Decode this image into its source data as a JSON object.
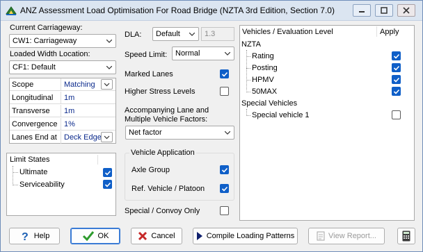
{
  "window": {
    "title": "ANZ Assessment Load Optimisation For Road Bridge (NZTA 3rd Edition, Section 7.0)",
    "accent": "#0f5fc8"
  },
  "left": {
    "carriageway_label": "Current Carriageway:",
    "carriageway_value": "CW1: Carriageway",
    "loaded_width_label": "Loaded Width Location:",
    "loaded_width_value": "CF1: Default",
    "grid": [
      {
        "key": "Scope",
        "value": "Matching",
        "has_dropdown": true
      },
      {
        "key": "Longitudinal",
        "value": "1m"
      },
      {
        "key": "Transverse",
        "value": "1m"
      },
      {
        "key": "Convergence",
        "value": "1%"
      },
      {
        "key": "Lanes End at",
        "value": "Deck Edge",
        "has_dropdown": true
      }
    ],
    "limit_states": {
      "title": "Limit States",
      "items": [
        {
          "label": "Ultimate",
          "checked": true
        },
        {
          "label": "Serviceability",
          "checked": true
        }
      ]
    }
  },
  "middle": {
    "dla_label": "DLA:",
    "dla_value": "Default",
    "dla_factor": "1.3",
    "speed_limit_label": "Speed Limit:",
    "speed_limit_value": "Normal",
    "marked_lanes_label": "Marked Lanes",
    "marked_lanes_checked": true,
    "higher_stress_label": "Higher Stress Levels",
    "higher_stress_checked": false,
    "accompanying_label_line1": "Accompanying Lane and",
    "accompanying_label_line2": "Multiple Vehicle Factors:",
    "accompanying_value": "Net factor",
    "vehicle_application": {
      "title": "Vehicle Application",
      "axle_group_label": "Axle Group",
      "axle_group_checked": true,
      "ref_vehicle_label": "Ref. Vehicle / Platoon",
      "ref_vehicle_checked": true
    },
    "special_convoy_label": "Special / Convoy Only",
    "special_convoy_checked": false
  },
  "right": {
    "col_vehicles": "Vehicles / Evaluation Level",
    "col_apply": "Apply",
    "groups": [
      {
        "name": "NZTA",
        "items": [
          {
            "label": "Rating",
            "checked": true
          },
          {
            "label": "Posting",
            "checked": true
          },
          {
            "label": "HPMV",
            "checked": true
          },
          {
            "label": "50MAX",
            "checked": true
          }
        ]
      },
      {
        "name": "Special Vehicles",
        "items": [
          {
            "label": "Special vehicle 1",
            "checked": false
          }
        ]
      }
    ]
  },
  "buttons": {
    "help": "Help",
    "ok": "OK",
    "cancel": "Cancel",
    "compile": "Compile Loading Patterns",
    "view_report": "View Report...",
    "calculator": "calculator-icon"
  }
}
